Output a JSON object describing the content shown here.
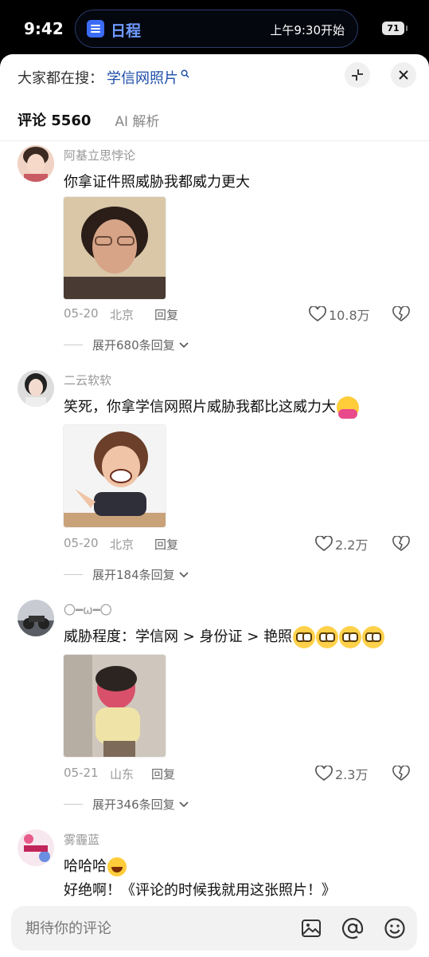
{
  "status_bar": {
    "time": "9:42",
    "island_app": "日程",
    "island_event": "上午9:30开始",
    "battery": "71"
  },
  "search": {
    "prefix": "大家都在搜：",
    "term": "学信网照片"
  },
  "tabs": {
    "comments": "评论 5560",
    "ai": "AI 解析"
  },
  "comments": [
    {
      "user": "阿基立思悖论",
      "text": "你拿证件照威胁我都威力更大",
      "date": "05-20",
      "location": "北京",
      "reply": "回复",
      "likes": "10.8万",
      "expand": "展开680条回复"
    },
    {
      "user": "二云软软",
      "text": "笑死，你拿学信网照片威胁我都比这威力大",
      "date": "05-20",
      "location": "北京",
      "reply": "回复",
      "likes": "2.2万",
      "expand": "展开184条回复"
    },
    {
      "user": "〇━ω━〇",
      "text": "威胁程度：学信网 > 身份证 > 艳照",
      "date": "05-21",
      "location": "山东",
      "reply": "回复",
      "likes": "2.3万",
      "expand": "展开346条回复"
    },
    {
      "user": "雾霾蓝",
      "text_a": "哈哈哈",
      "text_b": "好绝啊！《评论的时候我就用这张照片！》"
    }
  ],
  "input": {
    "placeholder": "期待你的评论"
  },
  "colors": {
    "accent": "#1e4ea8",
    "island_blue": "#6f9bff"
  }
}
